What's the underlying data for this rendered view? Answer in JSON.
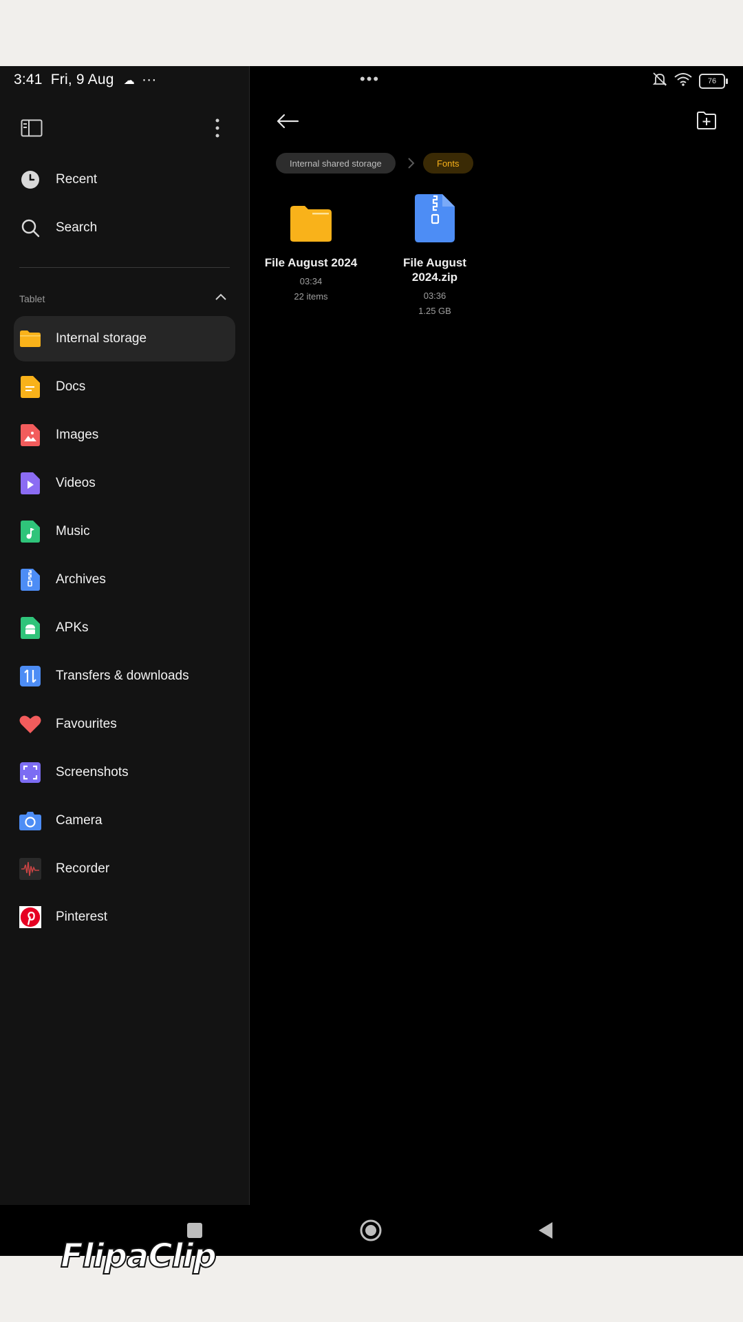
{
  "status_bar": {
    "time": "3:41",
    "date": "Fri, 9 Aug",
    "extra": "···",
    "center": "•••",
    "battery": "76"
  },
  "sidebar": {
    "top_items": [
      {
        "label": "Recent",
        "icon": "clock-icon"
      },
      {
        "label": "Search",
        "icon": "search-icon"
      }
    ],
    "section_title": "Tablet",
    "items": [
      {
        "label": "Internal storage",
        "icon": "folder-icon",
        "color": "#F9B21A",
        "active": true
      },
      {
        "label": "Docs",
        "icon": "doc-icon",
        "color": "#F9B21A"
      },
      {
        "label": "Images",
        "icon": "image-icon",
        "color": "#F25C5C"
      },
      {
        "label": "Videos",
        "icon": "video-icon",
        "color": "#8B6CF3"
      },
      {
        "label": "Music",
        "icon": "music-icon",
        "color": "#2FC47A"
      },
      {
        "label": "Archives",
        "icon": "archive-icon",
        "color": "#4D8DF5"
      },
      {
        "label": "APKs",
        "icon": "android-icon",
        "color": "#2FC47A"
      },
      {
        "label": "Transfers & downloads",
        "icon": "transfer-icon",
        "color": "#4D8DF5"
      },
      {
        "label": "Favourites",
        "icon": "heart-icon",
        "color": "#F25C5C"
      },
      {
        "label": "Screenshots",
        "icon": "screenshot-icon",
        "color": "#7C6CF3"
      },
      {
        "label": "Camera",
        "icon": "camera-icon",
        "color": "#4D8DF5"
      },
      {
        "label": "Recorder",
        "icon": "recorder-icon",
        "color": "#333333"
      },
      {
        "label": "Pinterest",
        "icon": "pinterest-icon",
        "color": "#E60023"
      }
    ]
  },
  "breadcrumb": {
    "root": "Internal shared storage",
    "current": "Fonts"
  },
  "files": [
    {
      "name": "File August 2024",
      "time": "03:34",
      "detail": "22 items",
      "type": "folder"
    },
    {
      "name": "File August 2024.zip",
      "time": "03:36",
      "detail": "1.25 GB",
      "type": "zip"
    }
  ],
  "watermark": "FlipaClip"
}
